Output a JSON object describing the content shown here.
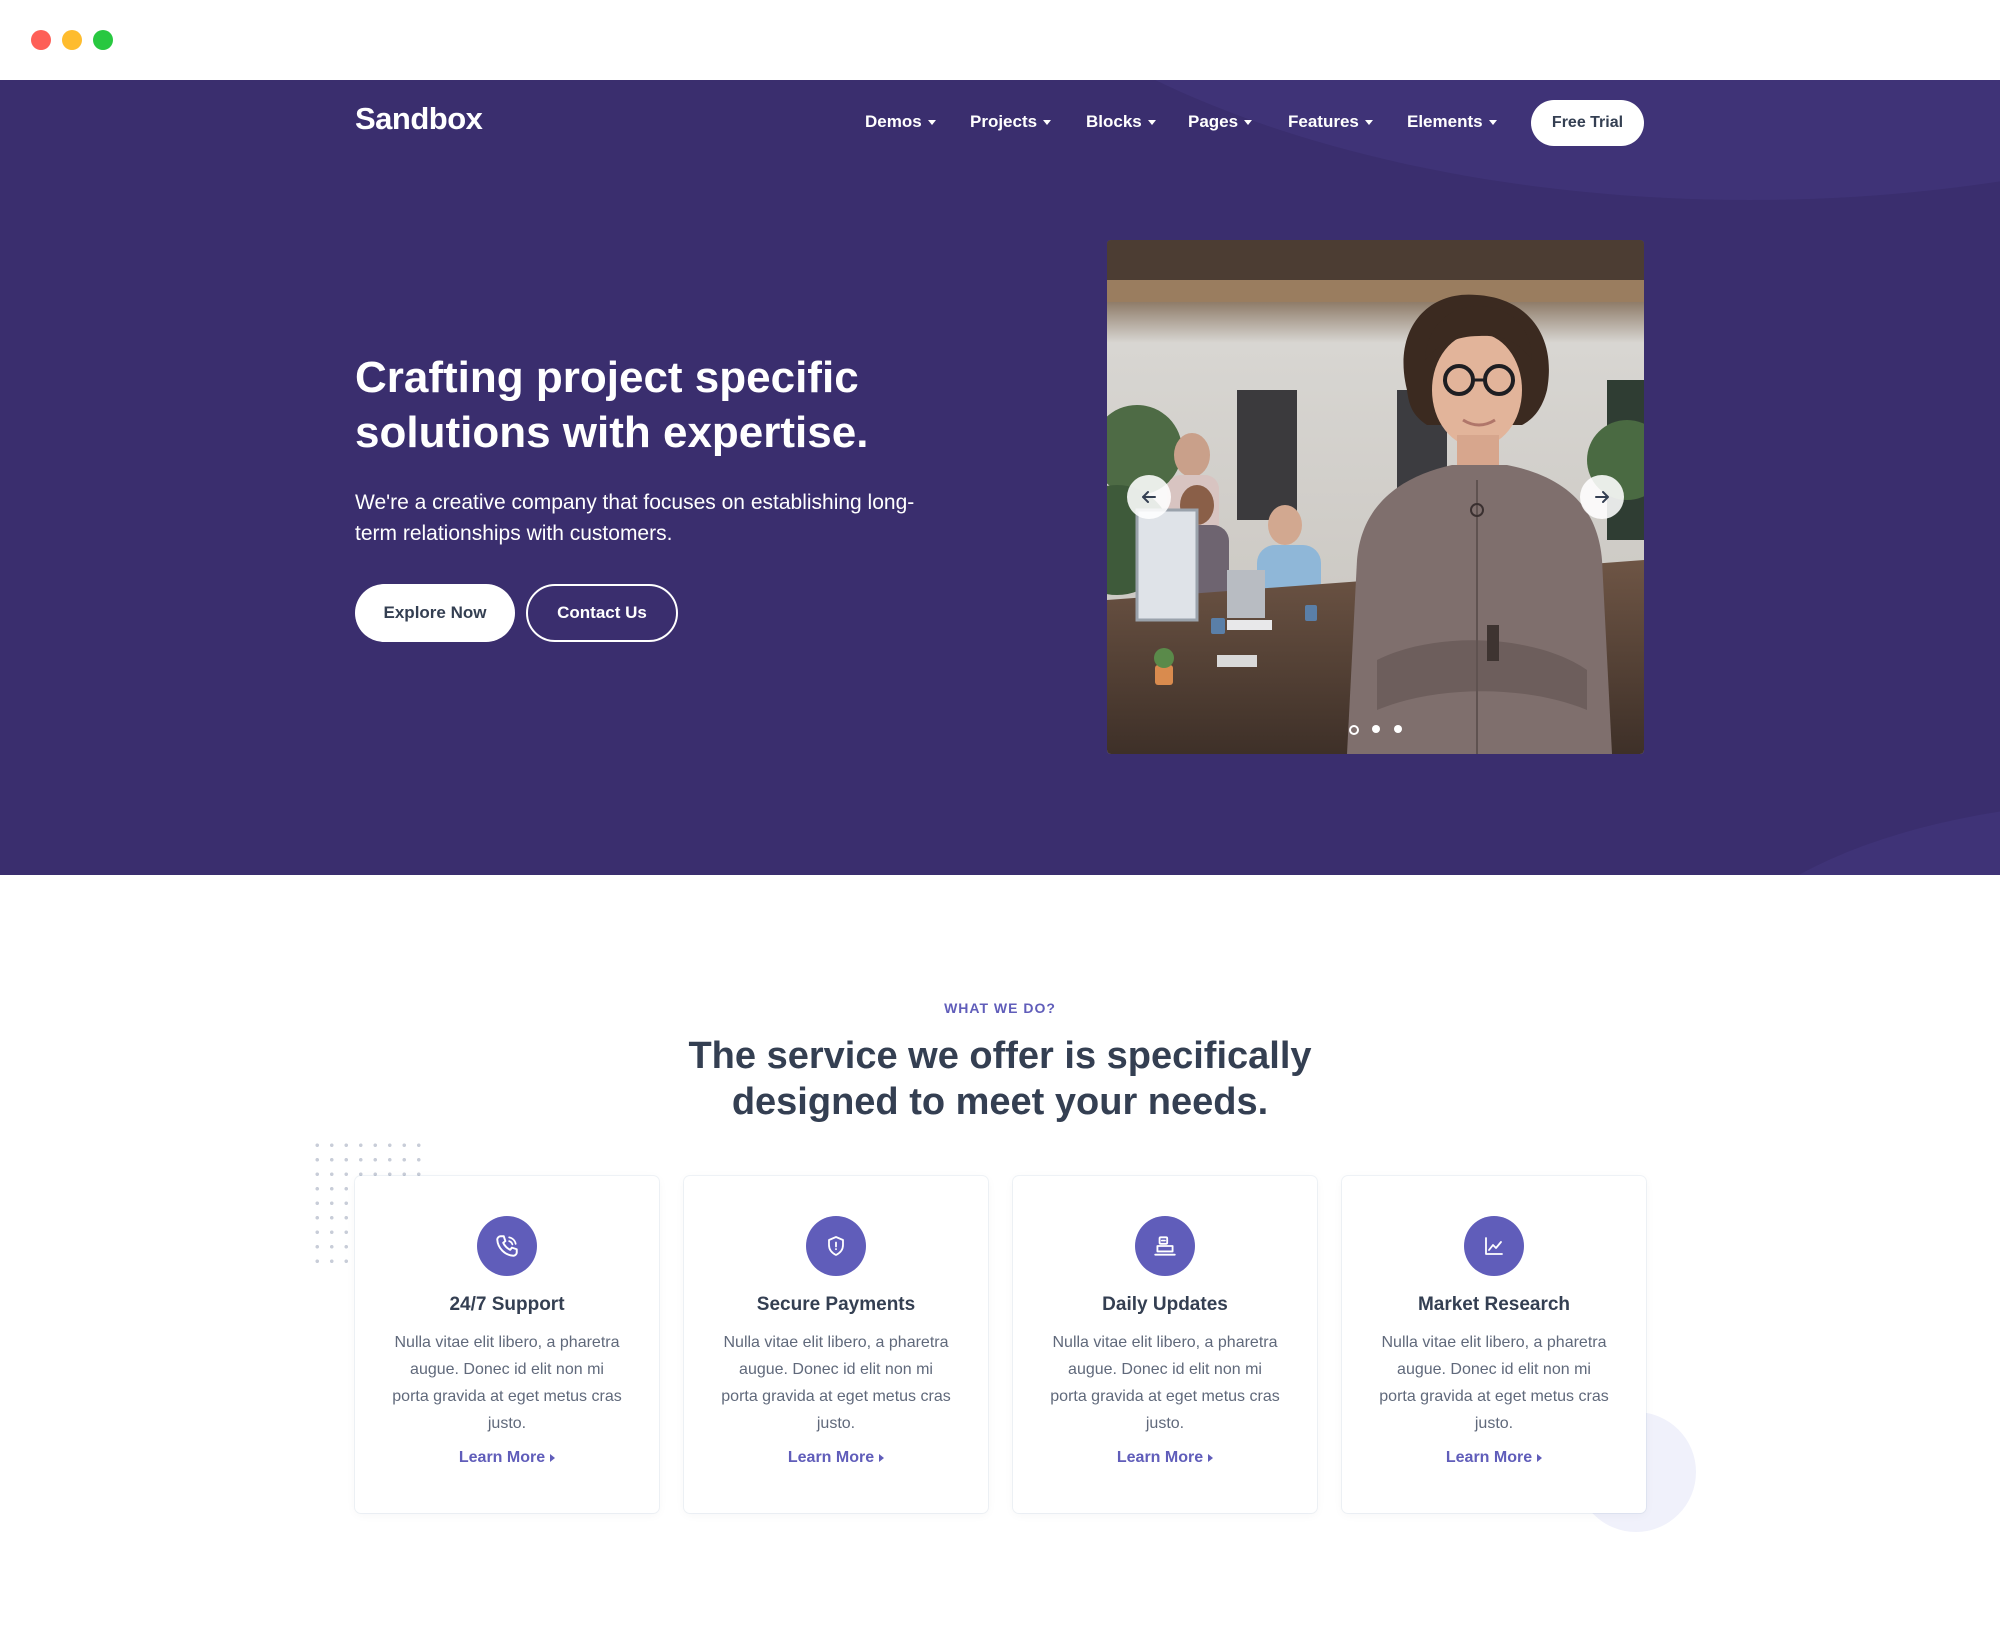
{
  "brand": {
    "logo_text": "Sandbox"
  },
  "nav": {
    "items": [
      {
        "label": "Demos"
      },
      {
        "label": "Projects"
      },
      {
        "label": "Blocks"
      },
      {
        "label": "Pages"
      },
      {
        "label": "Features"
      },
      {
        "label": "Elements"
      }
    ],
    "cta_label": "Free Trial"
  },
  "hero": {
    "title": "Crafting project specific solutions with expertise.",
    "text": "We're a creative company that focuses on establishing long-term relationships with customers.",
    "primary_button": "Explore Now",
    "secondary_button": "Contact Us",
    "slider": {
      "active_slide": 1,
      "slide_count": 3,
      "prev_icon": "arrow-left-icon",
      "next_icon": "arrow-right-icon"
    }
  },
  "services": {
    "eyebrow": "WHAT WE DO?",
    "title": "The service we offer is specifically designed to meet your needs.",
    "cards": [
      {
        "icon": "phone-icon",
        "title": "24/7 Support",
        "text": "Nulla vitae elit libero, a pharetra augue. Donec id elit non mi porta gravida at eget metus cras justo.",
        "link": "Learn More"
      },
      {
        "icon": "shield-icon",
        "title": "Secure Payments",
        "text": "Nulla vitae elit libero, a pharetra augue. Donec id elit non mi porta gravida at eget metus cras justo.",
        "link": "Learn More"
      },
      {
        "icon": "laptop-icon",
        "title": "Daily Updates",
        "text": "Nulla vitae elit libero, a pharetra augue. Donec id elit non mi porta gravida at eget metus cras justo.",
        "link": "Learn More"
      },
      {
        "icon": "chart-line-icon",
        "title": "Market Research",
        "text": "Nulla vitae elit libero, a pharetra augue. Donec id elit non mi porta gravida at eget metus cras justo.",
        "link": "Learn More"
      }
    ]
  },
  "colors": {
    "hero_background": "#3a2e6e",
    "accent": "#605dba",
    "heading": "#343f52",
    "body_text": "#60697b"
  }
}
